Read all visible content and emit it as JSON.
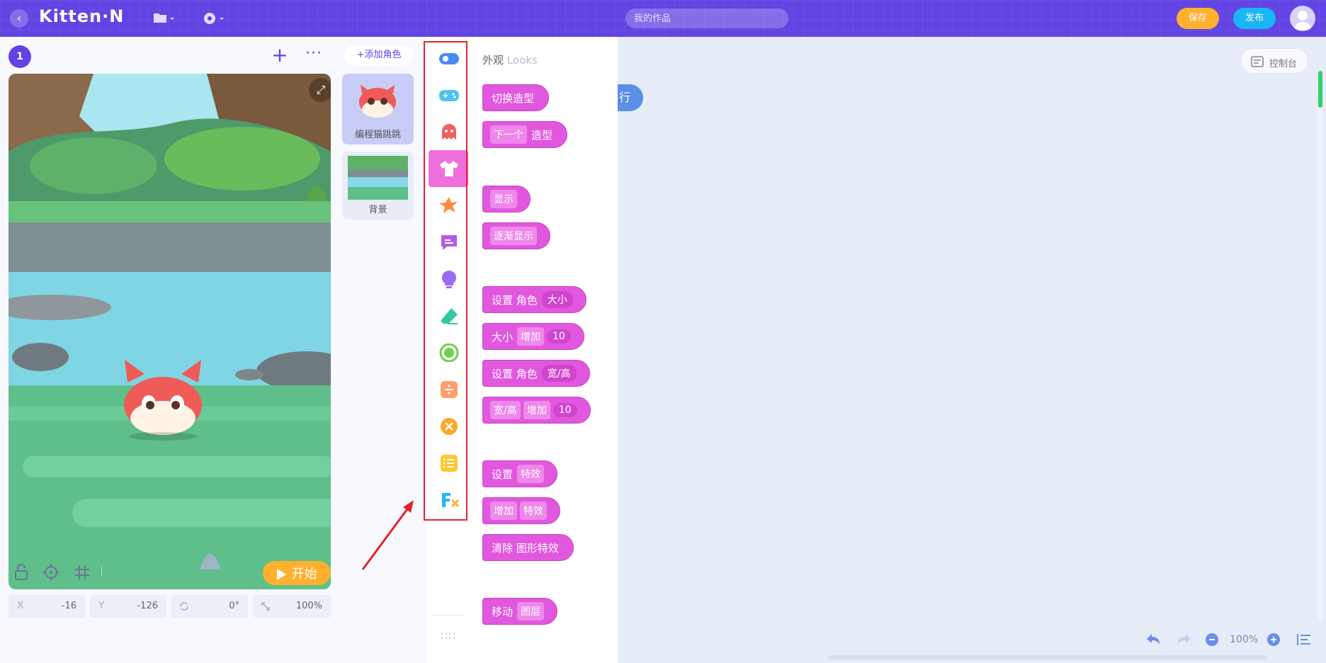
{
  "app": {
    "logo": "Kitten·N"
  },
  "topbar": {
    "search_placeholder": "我的作品",
    "save_label": "保存",
    "publish_label": "发布"
  },
  "stage": {
    "scene_number": "1",
    "start_label": "开始",
    "coords": {
      "x_label": "X",
      "x_value": "-16",
      "y_label": "Y",
      "y_value": "-126",
      "rotation_value": "0°",
      "scale_value": "100%"
    }
  },
  "sprites": {
    "add_role_label": "+添加角色",
    "items": [
      {
        "label": "编程猫跳跳"
      },
      {
        "label": "背景"
      }
    ]
  },
  "categories": [
    {
      "name": "events",
      "icon": "toggle-icon",
      "color": "#4a8cf5"
    },
    {
      "name": "controls",
      "icon": "gamepad-icon",
      "color": "#4dc3f5"
    },
    {
      "name": "actions",
      "icon": "ghost-icon",
      "color": "#f06060"
    },
    {
      "name": "looks",
      "icon": "shirt-icon",
      "color": "#ef6fdc",
      "active": true
    },
    {
      "name": "sound",
      "icon": "splash-icon",
      "color": "#ff8a3d"
    },
    {
      "name": "pen",
      "icon": "speech-bubble-icon",
      "color": "#b05de8"
    },
    {
      "name": "sense",
      "icon": "bulb-icon",
      "color": "#9b6cf2"
    },
    {
      "name": "draw",
      "icon": "eraser-icon",
      "color": "#33c9a0"
    },
    {
      "name": "operators",
      "icon": "circle-icon",
      "color": "#6fd04a"
    },
    {
      "name": "math",
      "icon": "divide-icon",
      "color": "#ff9f6b"
    },
    {
      "name": "variables",
      "icon": "x-circle-icon",
      "color": "#ffa727"
    },
    {
      "name": "lists",
      "icon": "list-icon",
      "color": "#ffc62e"
    },
    {
      "name": "functions",
      "icon": "fx-icon",
      "color": "#1fb8f5"
    }
  ],
  "palette": {
    "title_cn": "外观",
    "title_en": "Looks",
    "blocks": {
      "b1": [
        "切换造型"
      ],
      "b2": [
        "下一个",
        "造型"
      ],
      "b3": [
        "显示"
      ],
      "b4": [
        "逐渐显示"
      ],
      "b5": [
        "设置 角色",
        "大小"
      ],
      "b6": [
        "大小",
        "增加",
        "10"
      ],
      "b7": [
        "设置 角色",
        "宽/高"
      ],
      "b8": [
        "宽/高",
        "增加",
        "10"
      ],
      "b9": [
        "设置",
        "特效"
      ],
      "b10": [
        "增加",
        "特效"
      ],
      "b11": [
        "清除 图形特效"
      ],
      "b12": [
        "移动",
        "图层"
      ]
    }
  },
  "workspace": {
    "block_text": "行",
    "console_label": "控制台",
    "zoom_value": "100%"
  }
}
